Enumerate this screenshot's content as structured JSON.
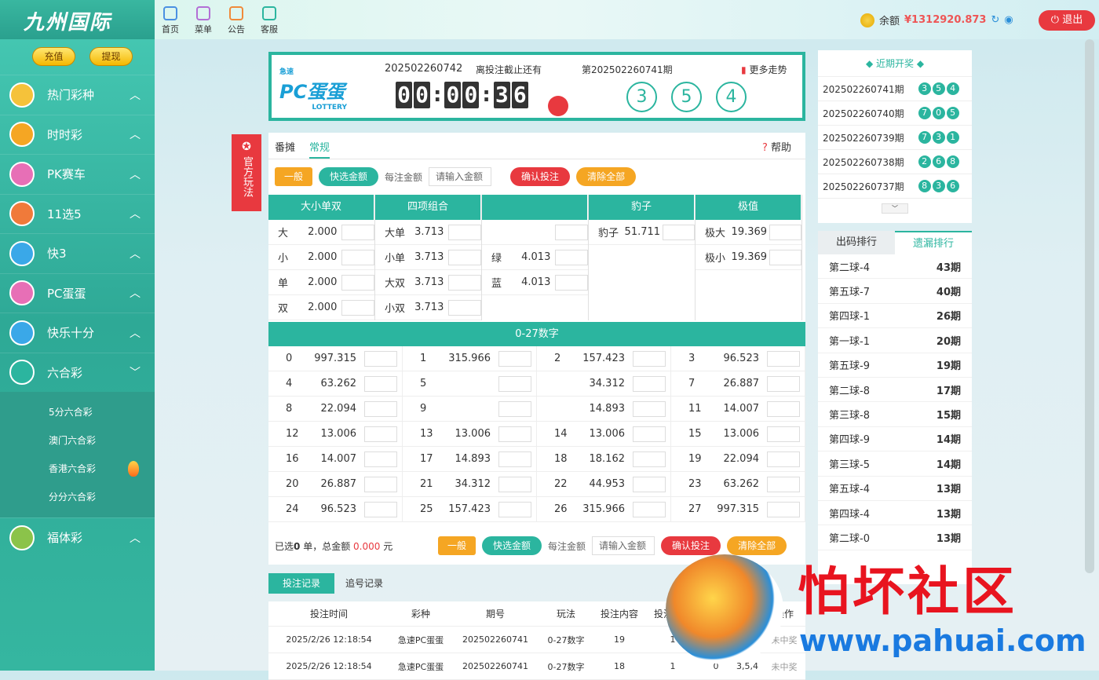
{
  "brand": {
    "name": "九州国际"
  },
  "topnav": [
    {
      "label": "首页",
      "icon": "home-icon",
      "color": "#4a90e2"
    },
    {
      "label": "菜单",
      "icon": "grid-icon",
      "color": "#b36fd6"
    },
    {
      "label": "公告",
      "icon": "megaphone-icon",
      "color": "#f08a3a"
    },
    {
      "label": "客服",
      "icon": "chat-icon",
      "color": "#2bb59f"
    }
  ],
  "account": {
    "balance_label": "余额",
    "balance_value": "¥1312920.873",
    "logout": "退出"
  },
  "sidebar": {
    "deposit": "充值",
    "withdraw": "提现",
    "items": [
      {
        "label": "热门彩种",
        "color": "#f5c23a"
      },
      {
        "label": "时时彩",
        "color": "#f5a623"
      },
      {
        "label": "PK赛车",
        "color": "#e76fb6"
      },
      {
        "label": "11选5",
        "color": "#f07a3a"
      },
      {
        "label": "快3",
        "color": "#3aa8e8"
      },
      {
        "label": "PC蛋蛋",
        "color": "#e76fb6"
      },
      {
        "label": "快乐十分",
        "color": "#3aa8e8"
      },
      {
        "label": "六合彩",
        "color": "#2bb59f"
      }
    ],
    "sub": [
      "5分六合彩",
      "澳门六合彩",
      "香港六合彩",
      "分分六合彩"
    ],
    "last": {
      "label": "福体彩",
      "color": "#8bc34a"
    }
  },
  "game": {
    "logo": "PC蛋蛋",
    "logo_small": "急速",
    "logo_en": "LOTTERY",
    "issue": "202502260742",
    "deadline_label": "离投注截止还有",
    "timer": [
      "0",
      "0",
      "0",
      "0",
      "3",
      "6"
    ],
    "last_issue": "第202502260741期",
    "trend": "更多走势",
    "balls": [
      "3",
      "5",
      "4"
    ]
  },
  "official": "官方玩法",
  "tabs": [
    "番摊",
    "常规"
  ],
  "help": "帮助",
  "controls": {
    "general": "一般",
    "quick": "快选金额",
    "per": "每注金额",
    "placeholder": "请输入金额",
    "confirm": "确认投注",
    "clear": "清除全部"
  },
  "groups": [
    {
      "title": "大小单双",
      "width": 136,
      "rows": [
        [
          "大",
          "2.000"
        ],
        [
          "小",
          "2.000"
        ],
        [
          "单",
          "2.000"
        ],
        [
          "双",
          "2.000"
        ]
      ]
    },
    {
      "title": "四项组合",
      "width": 136,
      "rows": [
        [
          "大单",
          "3.713"
        ],
        [
          "小单",
          "3.713"
        ],
        [
          "大双",
          "3.713"
        ],
        [
          "小双",
          "3.713"
        ]
      ]
    },
    {
      "title": "",
      "width": 136,
      "rows": [
        [
          "",
          "",
          ""
        ],
        [
          "绿",
          "4.013"
        ],
        [
          "蓝",
          "4.013"
        ]
      ]
    },
    {
      "title": "豹子",
      "width": 136,
      "rows": [
        [
          "豹子",
          "51.711"
        ]
      ]
    },
    {
      "title": "极值",
      "width": 136,
      "rows": [
        [
          "极大",
          "19.369"
        ],
        [
          "极小",
          "19.369"
        ]
      ]
    }
  ],
  "numbers_title": "0-27数字",
  "numbers": [
    [
      "0",
      "997.315"
    ],
    [
      "1",
      "315.966"
    ],
    [
      "2",
      "157.423"
    ],
    [
      "3",
      "96.523"
    ],
    [
      "4",
      "63.262"
    ],
    [
      "5",
      ""
    ],
    [
      "",
      "34.312"
    ],
    [
      "7",
      "26.887"
    ],
    [
      "8",
      "22.094"
    ],
    [
      "9",
      ""
    ],
    [
      "",
      "14.893"
    ],
    [
      "11",
      "14.007"
    ],
    [
      "12",
      "13.006"
    ],
    [
      "13",
      "13.006"
    ],
    [
      "14",
      "13.006"
    ],
    [
      "15",
      "13.006"
    ],
    [
      "16",
      "14.007"
    ],
    [
      "17",
      "14.893"
    ],
    [
      "18",
      "18.162"
    ],
    [
      "19",
      "22.094"
    ],
    [
      "20",
      "26.887"
    ],
    [
      "21",
      "34.312"
    ],
    [
      "22",
      "44.953"
    ],
    [
      "23",
      "63.262"
    ],
    [
      "24",
      "96.523"
    ],
    [
      "25",
      "157.423"
    ],
    [
      "26",
      "315.966"
    ],
    [
      "27",
      "997.315"
    ]
  ],
  "footer": {
    "selected_pre": "已选",
    "selected_count": "0",
    "selected_mid": "单，总金额",
    "total": "0.000",
    "unit": "元"
  },
  "records": {
    "tabs": [
      "投注记录",
      "追号记录"
    ],
    "headers": [
      "投注时间",
      "彩种",
      "期号",
      "玩法",
      "投注内容",
      "投注金额",
      "开奖号码",
      "状态(点击查看)",
      "操作"
    ],
    "rows": [
      [
        "2025/2/26 12:18:54",
        "急速PC蛋蛋",
        "202502260741",
        "0-27数字",
        "19",
        "1",
        "0",
        "3,5,4",
        "未中奖"
      ],
      [
        "2025/2/26 12:18:54",
        "急速PC蛋蛋",
        "202502260741",
        "0-27数字",
        "18",
        "1",
        "0",
        "3,5,4",
        "未中奖"
      ]
    ]
  },
  "recent": {
    "title": "近期开奖",
    "items": [
      [
        "202502260741期",
        [
          "3",
          "5",
          "4"
        ]
      ],
      [
        "202502260740期",
        [
          "7",
          "0",
          "5"
        ]
      ],
      [
        "202502260739期",
        [
          "7",
          "3",
          "1"
        ]
      ],
      [
        "202502260738期",
        [
          "2",
          "6",
          "8"
        ]
      ],
      [
        "202502260737期",
        [
          "8",
          "3",
          "6"
        ]
      ]
    ]
  },
  "rank": {
    "tabs": [
      "出码排行",
      "遗漏排行"
    ],
    "items": [
      [
        "第二球-4",
        "43期"
      ],
      [
        "第五球-7",
        "40期"
      ],
      [
        "第四球-1",
        "26期"
      ],
      [
        "第一球-1",
        "20期"
      ],
      [
        "第五球-9",
        "19期"
      ],
      [
        "第二球-8",
        "17期"
      ],
      [
        "第三球-8",
        "15期"
      ],
      [
        "第四球-9",
        "14期"
      ],
      [
        "第三球-5",
        "14期"
      ],
      [
        "第五球-4",
        "13期"
      ],
      [
        "第四球-4",
        "13期"
      ],
      [
        "第二球-0",
        "13期"
      ]
    ]
  },
  "watermark": {
    "text": "怕坏社区",
    "url": "www.pahuai.com"
  }
}
